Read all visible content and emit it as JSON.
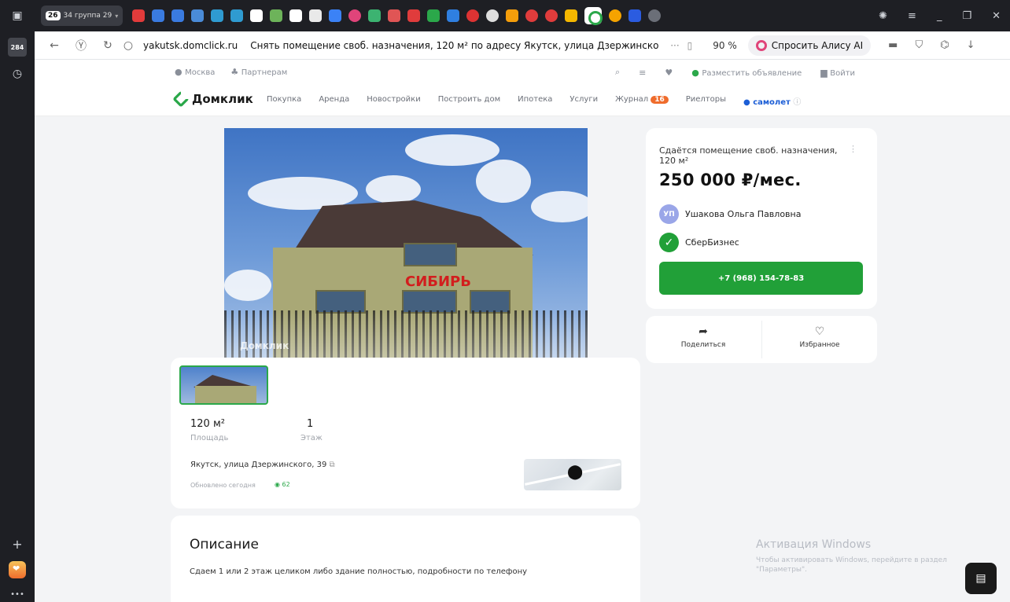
{
  "sidebar": {
    "badge": "284",
    "icons": [
      "panels-icon",
      "history-icon",
      "add-icon"
    ]
  },
  "tabs": {
    "group_count": "26",
    "group_label": "34 группа 29"
  },
  "addressbar": {
    "url": "yakutsk.domclick.ru",
    "page_title": "Снять помещение своб. назначения, 120 м² по адресу Якутск, улица Дзержинского, 39...",
    "zoom": "90 %",
    "alice_label": "Спросить Алису AI"
  },
  "utility": {
    "city": "Москва",
    "partners": "Партнерам",
    "post_ad": "Разместить объявление",
    "login": "Войти"
  },
  "nav": {
    "logo": "Домклик",
    "links": [
      "Покупка",
      "Аренда",
      "Новостройки",
      "Построить дом",
      "Ипотека",
      "Услуги"
    ],
    "journal": "Журнал",
    "journal_badge": "16",
    "realtors": "Риелторы",
    "samolet": "самолет"
  },
  "photo": {
    "sign": "СИБИРЬ",
    "watermark": "Домклик"
  },
  "listing": {
    "area_value": "120 м²",
    "area_label": "Площадь",
    "floor_value": "1",
    "floor_label": "Этаж",
    "address": "Якутск, улица Дзержинского, 39",
    "updated": "Обновлено сегодня",
    "views": "62"
  },
  "description": {
    "heading": "Описание",
    "text": "Сдаем 1 или 2 этаж целиком либо здание полностью, подробности по телефону"
  },
  "price_card": {
    "title": "Сдаётся помещение своб. назначения, 120 м²",
    "price": "250 000 ₽/мес.",
    "agent_initials": "УП",
    "agent_name": "Ушакова Ольга Павловна",
    "company": "СберБизнес",
    "phone": "+7 (968) 154-78-83"
  },
  "actions": {
    "share": "Поделиться",
    "favorite": "Избранное"
  },
  "windows": {
    "activation_title": "Активация Windows",
    "activation_text": "Чтобы активировать Windows, перейдите в раздел \"Параметры\"."
  }
}
